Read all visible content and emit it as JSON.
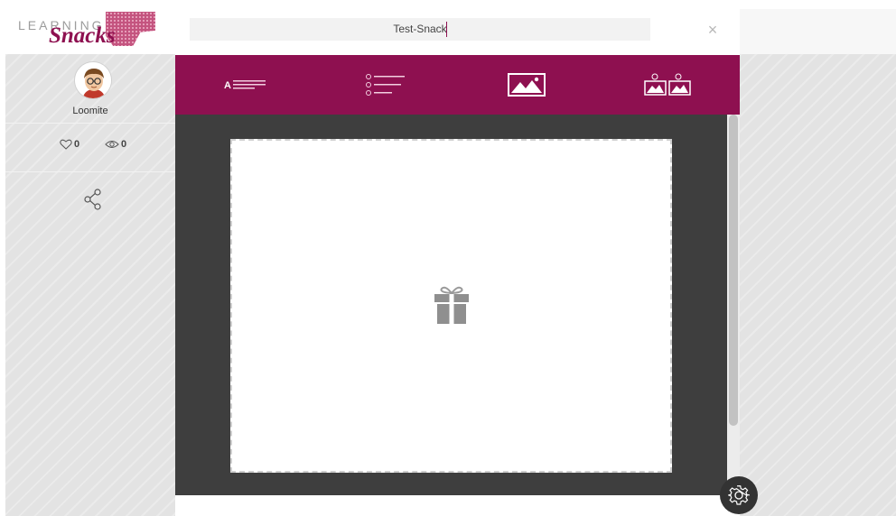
{
  "logo": {
    "learning_text": "LEARNING",
    "snacks_text": "Snacks"
  },
  "author": {
    "name": "Loomite"
  },
  "stats": {
    "likes": "0",
    "views": "0"
  },
  "editor": {
    "title_value": "Test-Snack",
    "close_label": "×",
    "tools": [
      {
        "name": "text-answer-tool",
        "icon": "text-lines-icon"
      },
      {
        "name": "multiple-choice-tool",
        "icon": "list-options-icon"
      },
      {
        "name": "image-tool",
        "icon": "image-icon"
      },
      {
        "name": "image-choice-tool",
        "icon": "multi-image-icon"
      }
    ],
    "slide_icon": "gift-icon"
  },
  "colors": {
    "brand": "#8e1050",
    "canvas_bg": "#3e3e3e",
    "settings_bg": "#333333"
  },
  "settings": {
    "icon": "gear-icon"
  }
}
